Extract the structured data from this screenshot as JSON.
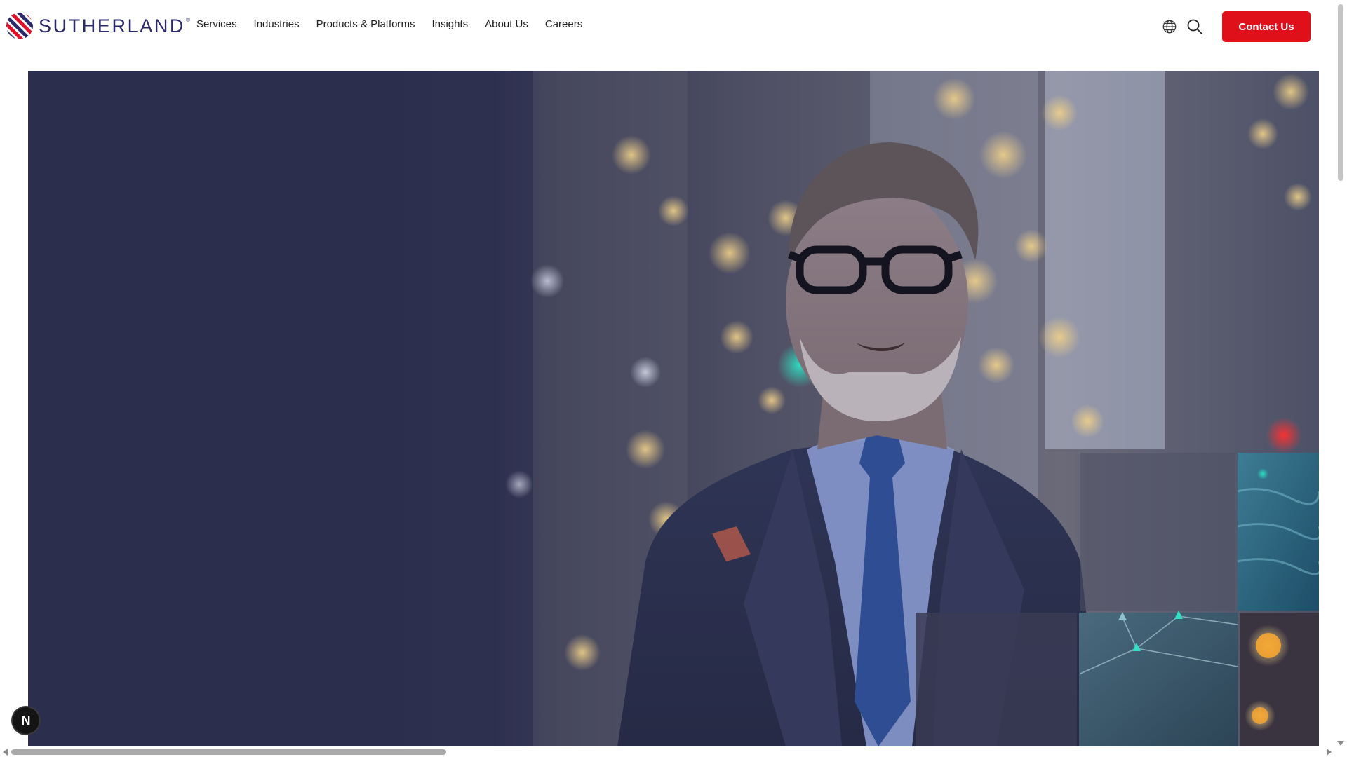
{
  "brand": {
    "name": "SUTHERLAND",
    "registered_mark": "®",
    "logo_colors": [
      "#e0102a",
      "#2b2a6b",
      "#e0102a"
    ]
  },
  "nav": {
    "items": [
      {
        "label": "Services"
      },
      {
        "label": "Industries"
      },
      {
        "label": "Products & Platforms"
      },
      {
        "label": "Insights"
      },
      {
        "label": "About Us"
      },
      {
        "label": "Careers"
      }
    ]
  },
  "header_actions": {
    "language_icon": "globe-icon",
    "search_icon": "search-icon",
    "contact_label": "Contact Us"
  },
  "hero": {
    "media": "video",
    "overlay_color": "#2c2e4d"
  },
  "badge": {
    "label": "N"
  },
  "colors": {
    "accent": "#e0101a",
    "brand_navy": "#2b2a6b",
    "hero_navy": "#2c2e4d"
  }
}
